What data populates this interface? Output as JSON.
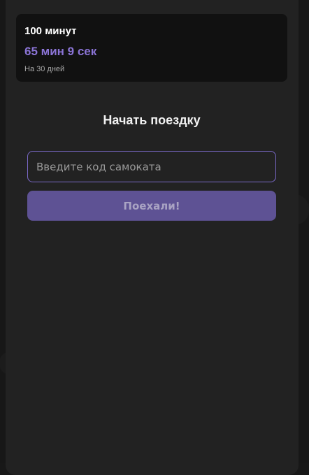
{
  "subscription": {
    "title": "100 минут",
    "remaining": "65 мин 9 сек",
    "period": "На 30 дней"
  },
  "ride": {
    "heading": "Начать поездку",
    "code_placeholder": "Введите код самоката",
    "code_value": "",
    "submit_label": "Поехали!"
  },
  "colors": {
    "accent": "#8b74d6",
    "button": "#5e5294",
    "panel": "#222222",
    "card": "#111111"
  }
}
